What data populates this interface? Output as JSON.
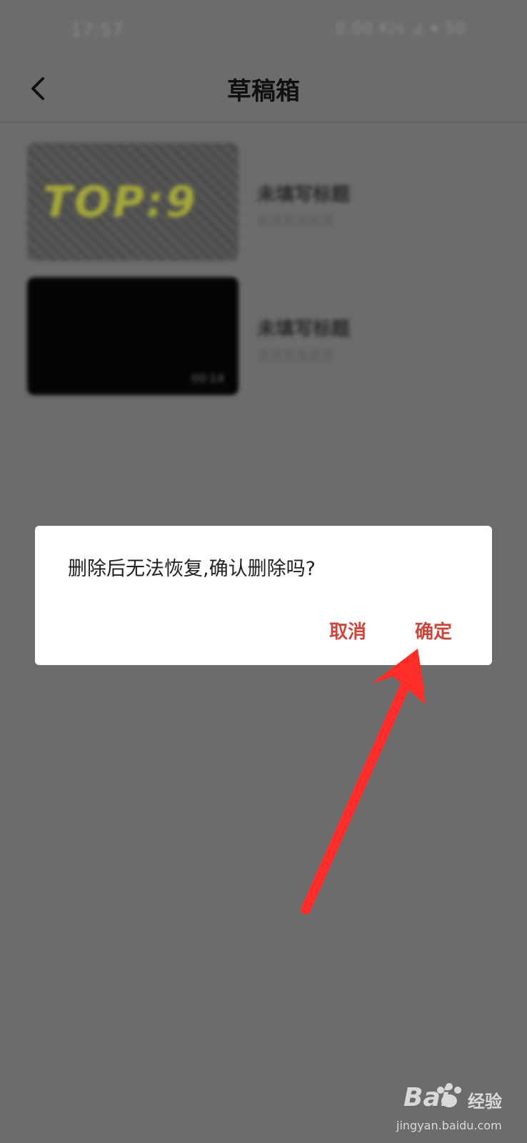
{
  "status_bar": {
    "time": "17:57",
    "indicators": "0.00 K/s ⊿ ▾ 50"
  },
  "header": {
    "title": "草稿箱",
    "back_icon": "chevron-left-icon"
  },
  "drafts": [
    {
      "thumbnail_text": "TOP:9",
      "title": "未填写标题",
      "subtitle": "某某某某某某"
    },
    {
      "thumbnail_text": "",
      "duration": "00:14",
      "title": "未填写标题",
      "subtitle": "某某某某某某"
    }
  ],
  "dialog": {
    "message": "删除后无法恢复,确认删除吗?",
    "cancel_label": "取消",
    "confirm_label": "确定"
  },
  "annotation": {
    "arrow_color": "#ff2d2a"
  },
  "watermark": {
    "logo": "Bai",
    "logo_suffix": "经验",
    "url": "jingyan.baidu.com"
  },
  "colors": {
    "overlay": "#6c6c6c",
    "accent": "#c9473c",
    "dialog_bg": "#ffffff"
  }
}
